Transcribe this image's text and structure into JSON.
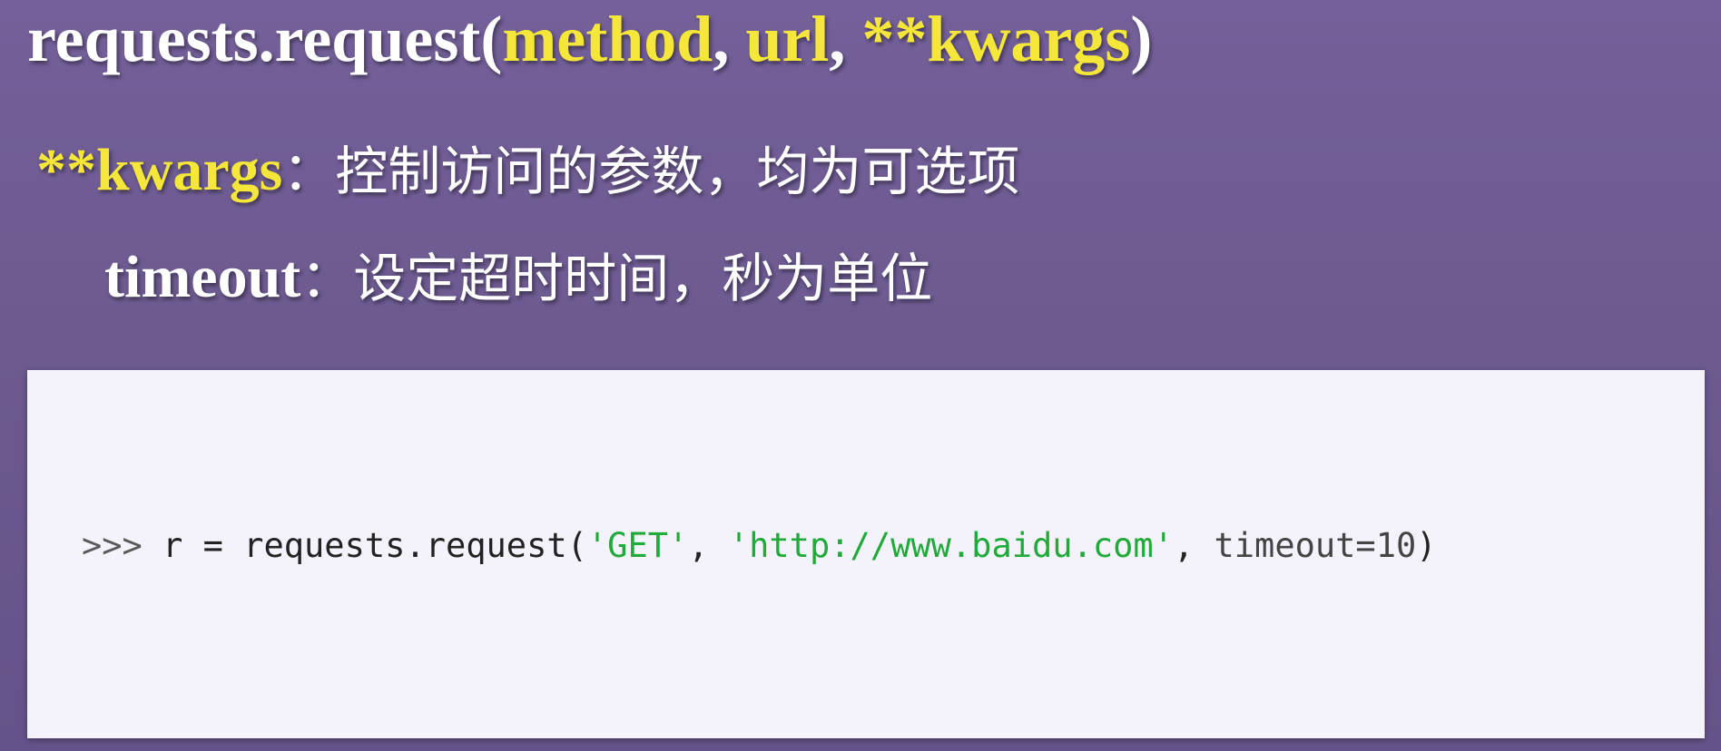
{
  "title": {
    "func": "requests.request(",
    "arg1": "method",
    "sep1": ", ",
    "arg2": "url",
    "sep2": ", ",
    "arg3": "**kwargs",
    "close": ")"
  },
  "kwargs_line": {
    "term": "**kwargs",
    "sep": "：",
    "desc": "控制访问的参数，均为可选项"
  },
  "timeout_line": {
    "term": "timeout",
    "sep": "：",
    "desc": "设定超时时间，秒为单位"
  },
  "code": {
    "prompt": ">>>",
    "before": " r = requests.request(",
    "str1": "'GET'",
    "comma1": ", ",
    "str2": "'http://www.baidu.com'",
    "comma2": ", ",
    "kwarg": "timeout=10",
    "close": ")"
  },
  "colors": {
    "background": "#6f5a8e",
    "highlight": "#f5e63a",
    "string": "#1faa3a",
    "code_bg": "#f4f2fb"
  }
}
